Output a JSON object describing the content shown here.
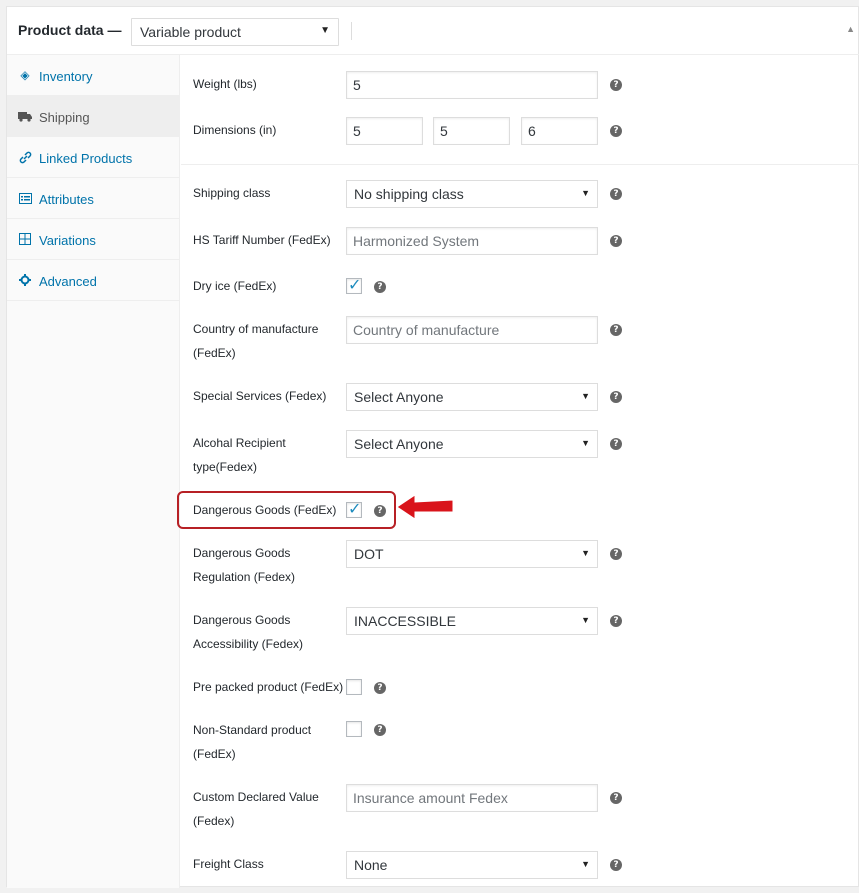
{
  "header": {
    "title": "Product data —",
    "product_type": "Variable product",
    "arrow": "▼",
    "collapse_icon": "▲"
  },
  "sidebar": {
    "items": [
      {
        "label": "Inventory",
        "icon": "tag-icon",
        "glyph": "◈"
      },
      {
        "label": "Shipping",
        "icon": "truck-icon",
        "glyph": "⛟"
      },
      {
        "label": "Linked Products",
        "icon": "link-icon",
        "glyph": "🔗"
      },
      {
        "label": "Attributes",
        "icon": "list-icon",
        "glyph": "▤"
      },
      {
        "label": "Variations",
        "icon": "grid-icon",
        "glyph": "⊞"
      },
      {
        "label": "Advanced",
        "icon": "gear-icon",
        "glyph": "✱"
      }
    ],
    "active": "Shipping"
  },
  "fields": {
    "weight": {
      "label": "Weight (lbs)",
      "value": "5"
    },
    "dimensions": {
      "label": "Dimensions (in)",
      "length": "5",
      "width": "5",
      "height": "6"
    },
    "shipping_class": {
      "label": "Shipping class",
      "value": "No shipping class"
    },
    "hs_tariff": {
      "label": "HS Tariff Number (FedEx)",
      "placeholder": "Harmonized System"
    },
    "dry_ice": {
      "label": "Dry ice (FedEx)",
      "checked": true
    },
    "country": {
      "label_1": "Country of manufacture",
      "label_2": "(FedEx)",
      "placeholder": "Country of manufacture"
    },
    "special_services": {
      "label": "Special Services (Fedex)",
      "value": "Select Anyone"
    },
    "alcohol": {
      "label_1": "Alcohal Recipient",
      "label_2": "type(Fedex)",
      "value": "Select Anyone"
    },
    "dangerous_goods": {
      "label": "Dangerous Goods (FedEx)",
      "checked": true
    },
    "dg_regulation": {
      "label_1": "Dangerous Goods",
      "label_2": "Regulation (Fedex)",
      "value": "DOT"
    },
    "dg_accessibility": {
      "label_1": "Dangerous Goods",
      "label_2": "Accessibility (Fedex)",
      "value": "INACCESSIBLE"
    },
    "pre_packed": {
      "label": "Pre packed product (FedEx)",
      "checked": false
    },
    "non_standard": {
      "label_1": "Non-Standard product",
      "label_2": "(FedEx)",
      "checked": false
    },
    "declared_value": {
      "label_1": "Custom Declared Value",
      "label_2": "(Fedex)",
      "placeholder": "Insurance amount Fedex"
    },
    "freight_class": {
      "label": "Freight Class",
      "value": "None"
    }
  },
  "help_glyph": "?",
  "check_glyph": "✓",
  "select_arrow": "▼",
  "colors": {
    "accent": "#0073aa",
    "annotation": "#d9141b",
    "highlight_border": "#b72025"
  }
}
